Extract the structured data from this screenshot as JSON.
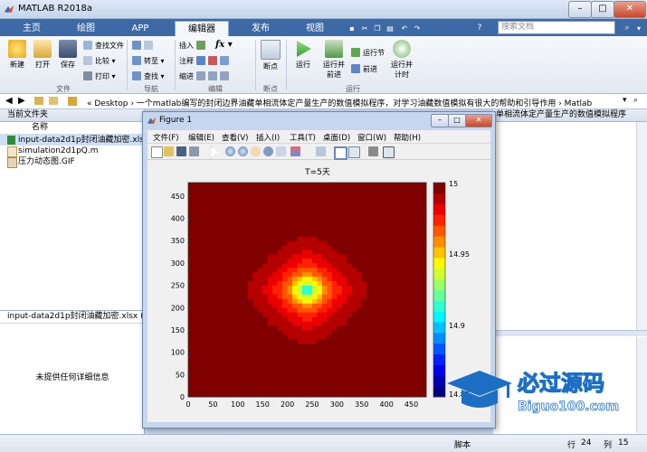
{
  "window": {
    "title": "MATLAB R2018a"
  },
  "tabs": [
    "主页",
    "绘图",
    "APP",
    "编辑器",
    "发布",
    "视图"
  ],
  "active_tab": "编辑器",
  "search": {
    "placeholder": "搜索文档"
  },
  "toolstrip": {
    "file": {
      "new": "新建",
      "open": "打开",
      "save": "保存",
      "find_files": "查找文件",
      "compare": "比较",
      "print": "打印",
      "group": "文件"
    },
    "navigate": {
      "goto": "转至",
      "find": "查找",
      "group": "导航"
    },
    "edit": {
      "insert": "插入",
      "comment": "注释",
      "indent": "缩进",
      "group": "编辑",
      "fx": "fx"
    },
    "breakpoints": {
      "label": "断点",
      "group": "断点"
    },
    "run": {
      "run": "运行",
      "run_advance_1": "运行并",
      "run_advance_2": "前进",
      "run_section": "运行节",
      "advance": "前进",
      "run_time_1": "运行并",
      "run_time_2": "计时",
      "group": "运行"
    }
  },
  "address": {
    "path": "« Desktop › 一个matlab编写的封闭边界油藏单相流体定产量生产的数值模拟程序，对学习油藏数值模拟有很大的帮助和引导作用 › Matlab"
  },
  "current_folder": {
    "title": "当前文件夹",
    "column": "名称",
    "files": [
      "input-data2d1p封闭油藏加密.xlsx",
      "simulation2d1pQ.m",
      "压力动态图.GIF"
    ],
    "selected_index": 0
  },
  "details": {
    "title": "input-data2d1p封闭油藏加密.xlsx  (...",
    "message": "未提供任何详细信息"
  },
  "right_pane": {
    "header": "单相流体定产量生产的数值模拟程序"
  },
  "status": {
    "script": "脚本",
    "row_label": "行",
    "row": "24",
    "col_label": "列",
    "col": "15"
  },
  "figure": {
    "title": "Figure 1",
    "menu": [
      "文件(F)",
      "编辑(E)",
      "查看(V)",
      "插入(I)",
      "工具(T)",
      "桌面(D)",
      "窗口(W)",
      "帮助(H)"
    ]
  },
  "watermark": {
    "text": "必过源码",
    "url": "Biguo100.com"
  },
  "chart_data": {
    "type": "heatmap",
    "title": "T=5天",
    "x_ticks": [
      0,
      50,
      100,
      150,
      200,
      250,
      300,
      350,
      400,
      450
    ],
    "y_ticks": [
      0,
      50,
      100,
      150,
      200,
      250,
      300,
      350,
      400,
      450
    ],
    "xlim": [
      0,
      480
    ],
    "ylim": [
      0,
      480
    ],
    "colorbar": {
      "min": 14.85,
      "max": 15,
      "ticks": [
        "15",
        "14.95",
        "14.9",
        "14.85"
      ],
      "colormap": "jet",
      "levels": 20
    },
    "field": {
      "center": [
        240,
        240
      ],
      "peak": 14.85,
      "edge": 15
    }
  }
}
